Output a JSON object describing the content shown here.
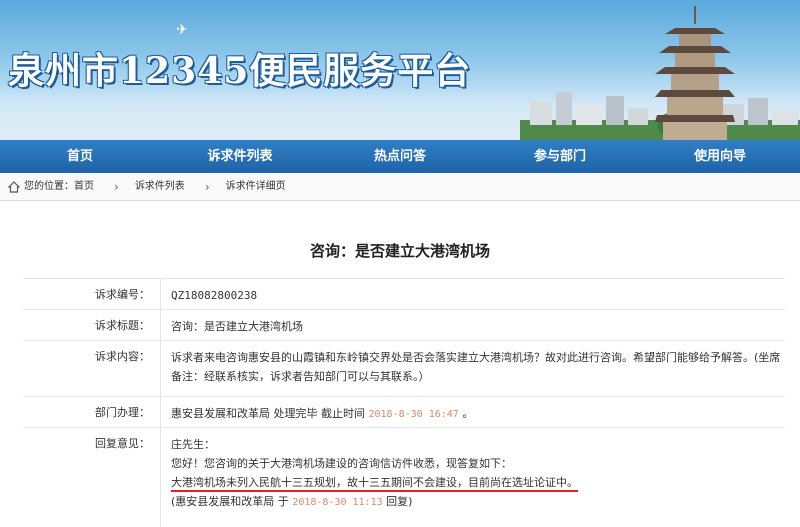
{
  "banner": {
    "title": "泉州市12345便民服务平台"
  },
  "nav": {
    "items": [
      "首页",
      "诉求件列表",
      "热点问答",
      "参与部门",
      "使用向导"
    ]
  },
  "breadcrumb": {
    "prefix": "您的位置：",
    "items": [
      "首页",
      "诉求件列表",
      "诉求件详细页"
    ]
  },
  "page": {
    "title": "咨询：是否建立大港湾机场"
  },
  "detail": {
    "number_key": "诉求编号：",
    "number_val": "QZ18082800238",
    "subject_key": "诉求标题：",
    "subject_val": "咨询：是否建立大港湾机场",
    "content_key": "诉求内容：",
    "content_val": "诉求者来电咨询惠安县的山霞镇和东岭镇交界处是否会落实建立大港湾机场？故对此进行咨询。希望部门能够给予解答。(坐席备注：经联系核实，诉求者告知部门可以与其联系。）",
    "dept_key": "部门办理：",
    "dept_val": "惠安县发展和改革局 处理完毕  截止时间",
    "dept_time": "2018-8-30 16:47",
    "dept_end": "。",
    "reply_key": "回复意见：",
    "reply_greeting": "庄先生：",
    "reply_line1": "您好！您咨询的关于大港湾机场建设的咨询信访件收悉，现答复如下：",
    "reply_line2": "大港湾机场未列入民航十三五规划，故十三五期间不会建设，目前尚在选址论证中。",
    "reply_sign_pre": "(惠安县发展和改革局 于",
    "reply_sign_time": "2018-8-30 11:13",
    "reply_sign_post": "回复)"
  }
}
